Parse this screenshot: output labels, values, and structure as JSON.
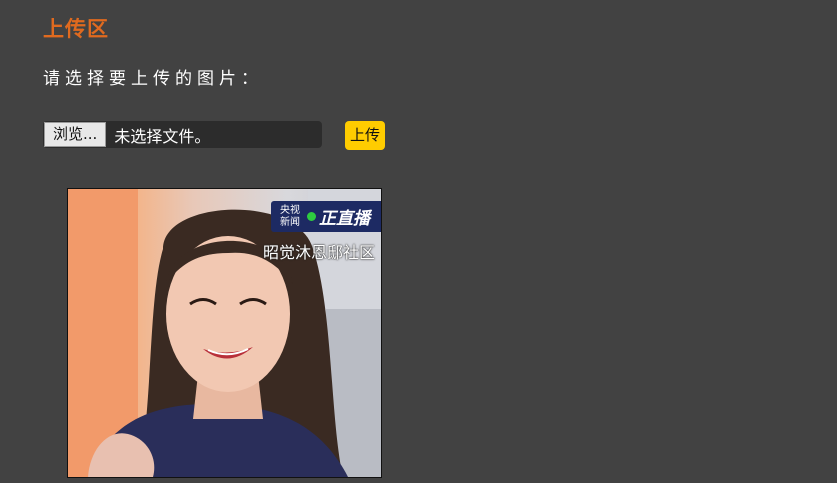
{
  "section": {
    "title": "上传区",
    "prompt": "请选择要上传的图片："
  },
  "file_input": {
    "browse_label": "浏览...",
    "status": "未选择文件。"
  },
  "upload_button": {
    "label": "上传"
  },
  "preview": {
    "badge_channel_line1": "央视",
    "badge_channel_line2": "新闻",
    "badge_live_text": "正直播",
    "caption": "昭觉沐恩邸社区"
  },
  "colors": {
    "background": "#424242",
    "title": "#e06a1f",
    "upload_button": "#ffcc00",
    "live_dot": "#2ecc40"
  }
}
